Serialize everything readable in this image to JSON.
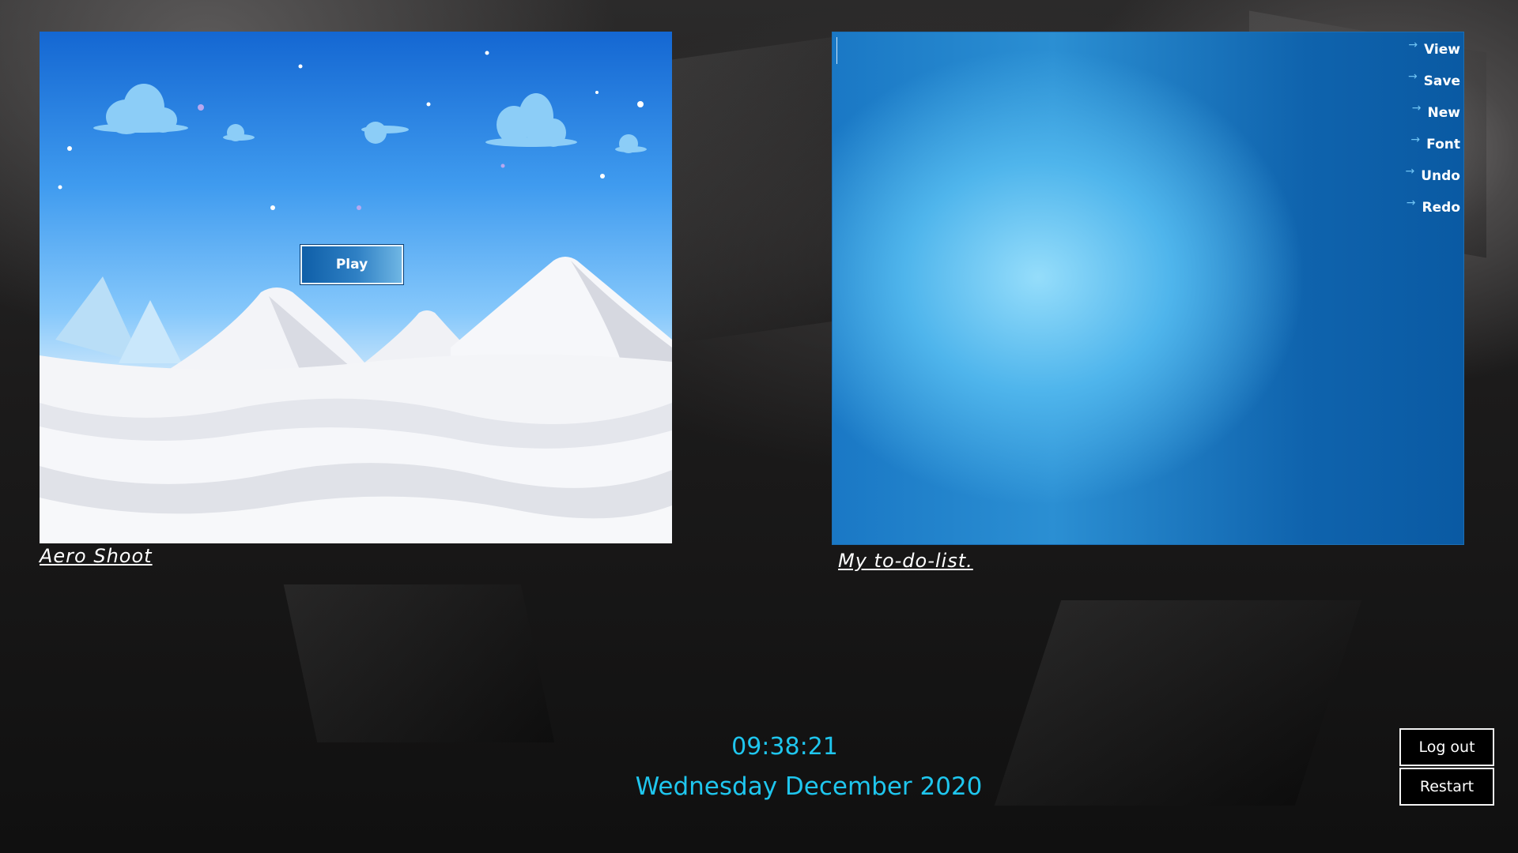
{
  "game": {
    "play_label": "Play",
    "title": "Aero Shoot"
  },
  "todo": {
    "text": "",
    "menu": [
      {
        "label": "View",
        "icon": "arrow-right-icon"
      },
      {
        "label": "Save",
        "icon": "arrow-right-icon"
      },
      {
        "label": "New",
        "icon": "arrow-right-icon"
      },
      {
        "label": "Font",
        "icon": "arrow-right-icon"
      },
      {
        "label": "Undo",
        "icon": "arrow-right-icon"
      },
      {
        "label": "Redo",
        "icon": "arrow-right-icon"
      }
    ],
    "title": "My to-do-list."
  },
  "clock": {
    "time": "09:38:21",
    "date": "Wednesday December 2020"
  },
  "session": {
    "logout_label": "Log out",
    "restart_label": "Restart"
  },
  "colors": {
    "clock_text": "#1fc6ee",
    "todo_panel": "#1a78c5",
    "play_button": "#0f5fa8"
  }
}
